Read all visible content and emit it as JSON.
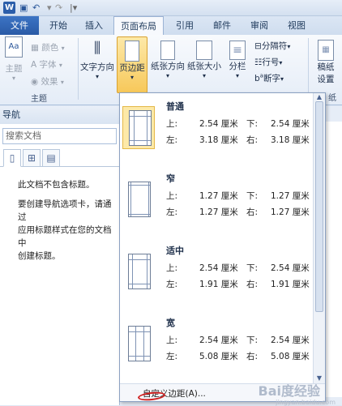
{
  "titlebar": {
    "word_logo": "W",
    "save_icon": "save-icon",
    "undo": "↶",
    "redo": "↷"
  },
  "tabs": {
    "file": "文件",
    "home": "开始",
    "insert": "插入",
    "page_layout": "页面布局",
    "references": "引用",
    "mailings": "邮件",
    "review": "审阅",
    "view": "视图"
  },
  "ribbon": {
    "theme_group": {
      "theme": "主题",
      "colors": "颜色",
      "fonts": "字体",
      "effects": "效果",
      "label": "主题"
    },
    "page_setup": {
      "text_direction": "文字方向",
      "margins": "页边距",
      "orientation": "纸张方向",
      "size": "纸张大小",
      "columns": "分栏",
      "breaks": "分隔符",
      "line_numbers": "行号",
      "hyphenation": "断字"
    },
    "manuscript": {
      "label1": "稿纸",
      "label2": "设置",
      "group": "纸"
    }
  },
  "nav": {
    "title": "导航",
    "search_placeholder": "搜索文档",
    "line1": "此文档不包含标题。",
    "line2": "要创建导航选项卡，请通过",
    "line3": "应用标题样式在您的文档中",
    "line4": "创建标题。"
  },
  "margins": [
    {
      "name": "普通",
      "top_label": "上:",
      "top": "2.54 厘米",
      "bottom_label": "下:",
      "bottom": "2.54 厘米",
      "left_label": "左:",
      "left": "3.18 厘米",
      "right_label": "右:",
      "right": "3.18 厘米"
    },
    {
      "name": "窄",
      "top_label": "上:",
      "top": "1.27 厘米",
      "bottom_label": "下:",
      "bottom": "1.27 厘米",
      "left_label": "左:",
      "left": "1.27 厘米",
      "right_label": "右:",
      "right": "1.27 厘米"
    },
    {
      "name": "适中",
      "top_label": "上:",
      "top": "2.54 厘米",
      "bottom_label": "下:",
      "bottom": "2.54 厘米",
      "left_label": "左:",
      "left": "1.91 厘米",
      "right_label": "右:",
      "right": "1.91 厘米"
    },
    {
      "name": "宽",
      "top_label": "上:",
      "top": "2.54 厘米",
      "bottom_label": "下:",
      "bottom": "2.54 厘米",
      "left_label": "左:",
      "left": "5.08 厘米",
      "right_label": "右:",
      "right": "5.08 厘米"
    }
  ],
  "custom_margins": "自定义边距(A)...",
  "watermark": {
    "main": "Bai度经验",
    "sub": "jingyan.baidu.com"
  },
  "colors": {
    "accent": "#2b579a",
    "highlight": "#fde9a8",
    "red_mark": "#d02020"
  }
}
